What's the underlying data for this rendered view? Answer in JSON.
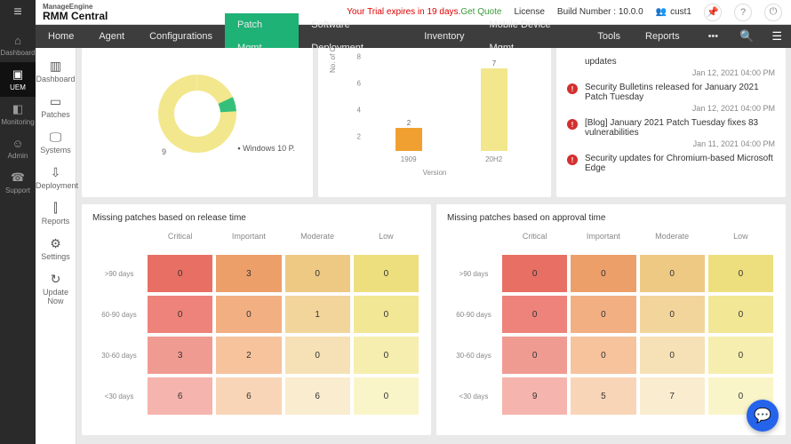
{
  "brand": {
    "top": "ManageEngine",
    "main": "RMM Central"
  },
  "top": {
    "trial": "Your Trial expires in 19 days.",
    "get_quote": "Get Quote",
    "license": "License",
    "build": "Build Number : 10.0.0",
    "user": "cust1"
  },
  "leftrail": [
    {
      "icon": "⌂",
      "label": "Dashboard"
    },
    {
      "icon": "▣",
      "label": "UEM",
      "active": true
    },
    {
      "icon": "◧",
      "label": "Monitoring"
    },
    {
      "icon": "☺",
      "label": "Admin"
    },
    {
      "icon": "☎",
      "label": "Support"
    }
  ],
  "hnav": [
    "Home",
    "Agent",
    "Configurations",
    "Patch Mgmt",
    "Software Deployment",
    "Inventory",
    "Mobile Device Mgmt",
    "Tools",
    "Reports"
  ],
  "hnav_active": 3,
  "subnav": [
    {
      "icon": "▥",
      "label": "Dashboard"
    },
    {
      "icon": "▭",
      "label": "Patches"
    },
    {
      "icon": "🖵",
      "label": "Systems"
    },
    {
      "icon": "⇩",
      "label": "Deployment"
    },
    {
      "icon": "⫿",
      "label": "Reports"
    },
    {
      "icon": "⚙",
      "label": "Settings"
    },
    {
      "icon": "↻",
      "label": "Update Now"
    }
  ],
  "chart_data": [
    {
      "type": "pie",
      "title": "",
      "values": [
        9
      ],
      "categories": [
        "Windows 10 P."
      ],
      "colors": [
        "#f2e78c"
      ],
      "accent": {
        "start": 0.18,
        "end": 0.24,
        "color": "#34c07a"
      },
      "center_label": "9"
    },
    {
      "type": "bar",
      "title": "",
      "categories": [
        "1909",
        "20H2"
      ],
      "values": [
        2,
        7
      ],
      "colors": [
        "#f0a030",
        "#f2e78c"
      ],
      "ylabel": "No. of Comp",
      "xlabel": "Version",
      "ylim": [
        0,
        8
      ],
      "yticks": [
        2,
        4,
        6,
        8
      ]
    },
    {
      "type": "heatmap",
      "title": "Missing patches based on release time",
      "rows": [
        ">90 days",
        "60-90 days",
        "30-60 days",
        "<30 days"
      ],
      "cols": [
        "Critical",
        "Important",
        "Moderate",
        "Low"
      ],
      "data": [
        [
          0,
          3,
          0,
          0
        ],
        [
          0,
          0,
          1,
          0
        ],
        [
          3,
          2,
          0,
          0
        ],
        [
          6,
          6,
          6,
          0
        ]
      ],
      "palette": {
        "Critical": [
          "#e86f63",
          "#ed837a",
          "#f09b92",
          "#f5b4ad"
        ],
        "Important": [
          "#ed9f6a",
          "#f2b082",
          "#f6c39d",
          "#f9d5b7"
        ],
        "Moderate": [
          "#eec984",
          "#f2d59b",
          "#f6e1b6",
          "#faeccf"
        ],
        "Low": [
          "#eedf7e",
          "#f2e795",
          "#f6eeae",
          "#faf5c9"
        ]
      }
    },
    {
      "type": "heatmap",
      "title": "Missing patches based on approval time",
      "rows": [
        ">90 days",
        "60-90 days",
        "30-60 days",
        "<30 days"
      ],
      "cols": [
        "Critical",
        "Important",
        "Moderate",
        "Low"
      ],
      "data": [
        [
          0,
          0,
          0,
          0
        ],
        [
          0,
          0,
          0,
          0
        ],
        [
          0,
          0,
          0,
          0
        ],
        [
          9,
          5,
          7,
          0
        ]
      ],
      "palette": {
        "Critical": [
          "#e86f63",
          "#ed837a",
          "#f09b92",
          "#f5b4ad"
        ],
        "Important": [
          "#ed9f6a",
          "#f2b082",
          "#f6c39d",
          "#f9d5b7"
        ],
        "Moderate": [
          "#eec984",
          "#f2d59b",
          "#f6e1b6",
          "#faeccf"
        ],
        "Low": [
          "#eedf7e",
          "#f2e795",
          "#f6eeae",
          "#faf5c9"
        ]
      }
    }
  ],
  "news": [
    {
      "title": "updates",
      "date": "Jan 12, 2021 04:00 PM",
      "partial": true
    },
    {
      "title": "Security Bulletins released for January 2021 Patch Tuesday",
      "date": "Jan 12, 2021 04:00 PM"
    },
    {
      "title": "[Blog] January 2021 Patch Tuesday fixes 83 vulnerabilities",
      "date": "Jan 11, 2021 04:00 PM"
    },
    {
      "title": "Security updates for Chromium-based Microsoft Edge",
      "date": ""
    }
  ]
}
